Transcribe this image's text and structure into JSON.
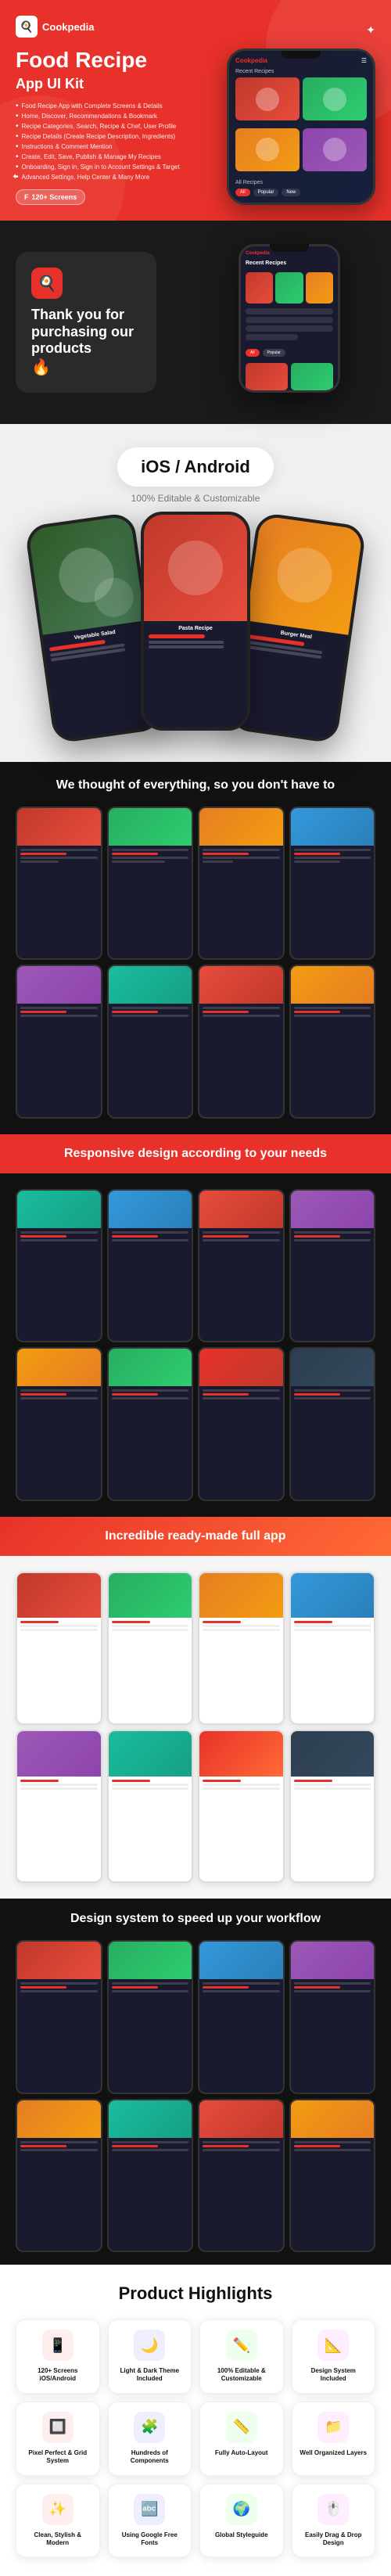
{
  "brand": {
    "name": "Cookpedia",
    "icon": "🍳"
  },
  "hero": {
    "title": "Food Recipe",
    "subtitle": "App UI Kit",
    "features": [
      "Food Recipe App with Complete Screens & Details",
      "Home, Discover, Recommendations & Bookmark",
      "Recipe Categories, Search, Recipe & Chef, User Profile",
      "Recipe Details (Create Recipe Description, Ingredients)",
      "Instructions & Comment Mention",
      "Create, Edit, Save, Publish & Manage My Recipes",
      "Onboarding, Sign in, Sign in to Account Settings & Target",
      "Advanced Settings, Help Center & Many More"
    ],
    "screens_badge": "120+ Screens"
  },
  "thankyou": {
    "text": "Thank you for purchasing our products",
    "emoji": "🔥"
  },
  "platform": {
    "title": "iOS / Android",
    "subtitle": "100% Editable & Customizable"
  },
  "sections": {
    "tagline1": "We thought of everything, so you don't have to",
    "tagline2": "Responsive design according to your needs",
    "tagline3": "Incredible ready-made full app",
    "tagline4": "Design system to speed up your workflow"
  },
  "highlights": {
    "title": "Product Highlights",
    "cards": [
      {
        "icon": "📱",
        "label": "120+ Screens iOS/Android",
        "color": "hib-red"
      },
      {
        "icon": "🌙",
        "label": "Light & Dark Theme Included",
        "color": "hib-blue"
      },
      {
        "icon": "✏️",
        "label": "100% Editable & Customizable",
        "color": "hib-green"
      },
      {
        "icon": "📐",
        "label": "Design System Included",
        "color": "hib-orange"
      },
      {
        "icon": "🔲",
        "label": "Pixel Perfect & Grid System",
        "color": "hib-red"
      },
      {
        "icon": "🧩",
        "label": "Hundreds of Components",
        "color": "hib-blue"
      },
      {
        "icon": "📏",
        "label": "Fully Auto-Layout",
        "color": "hib-green"
      },
      {
        "icon": "📁",
        "label": "Well Organized Layers",
        "color": "hib-orange"
      },
      {
        "icon": "✨",
        "label": "Clean, Stylish & Modern",
        "color": "hib-red"
      },
      {
        "icon": "🔤",
        "label": "Using Google Free Fonts",
        "color": "hib-blue"
      },
      {
        "icon": "🌍",
        "label": "Global Styleguide",
        "color": "hib-green"
      },
      {
        "icon": "🖱️",
        "label": "Easily Drag & Drop Design",
        "color": "hib-orange"
      }
    ]
  }
}
